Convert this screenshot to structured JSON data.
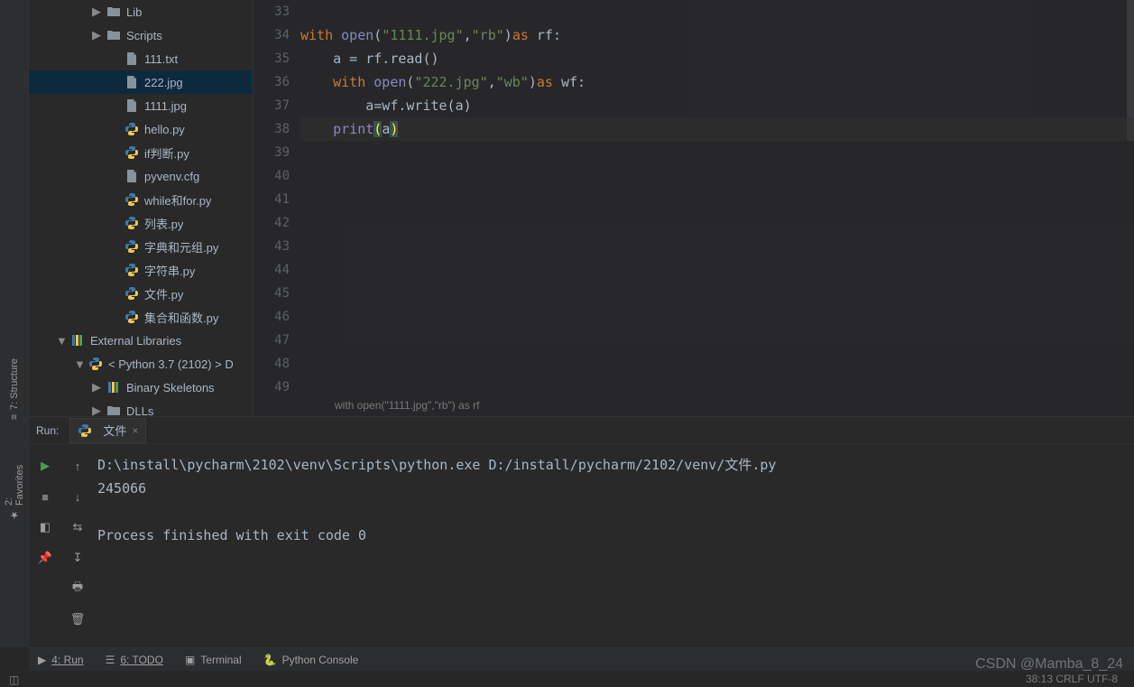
{
  "tree": [
    {
      "depth": 2,
      "exp": "▶",
      "type": "folder",
      "label": "Lib"
    },
    {
      "depth": 2,
      "exp": "▶",
      "type": "folder",
      "label": "Scripts"
    },
    {
      "depth": 3,
      "exp": "",
      "type": "file",
      "label": "111.txt"
    },
    {
      "depth": 3,
      "exp": "",
      "type": "file",
      "label": "222.jpg",
      "selected": true
    },
    {
      "depth": 3,
      "exp": "",
      "type": "file",
      "label": "1111.jpg"
    },
    {
      "depth": 3,
      "exp": "",
      "type": "py",
      "label": "hello.py"
    },
    {
      "depth": 3,
      "exp": "",
      "type": "py",
      "label": "if判断.py"
    },
    {
      "depth": 3,
      "exp": "",
      "type": "file",
      "label": "pyvenv.cfg"
    },
    {
      "depth": 3,
      "exp": "",
      "type": "py",
      "label": "while和for.py"
    },
    {
      "depth": 3,
      "exp": "",
      "type": "py",
      "label": "列表.py"
    },
    {
      "depth": 3,
      "exp": "",
      "type": "py",
      "label": "字典和元组.py"
    },
    {
      "depth": 3,
      "exp": "",
      "type": "py",
      "label": "字符串.py"
    },
    {
      "depth": 3,
      "exp": "",
      "type": "py",
      "label": "文件.py"
    },
    {
      "depth": 3,
      "exp": "",
      "type": "py",
      "label": "集合和函数.py"
    },
    {
      "depth": 0,
      "exp": "▼",
      "type": "libs",
      "label": "External Libraries"
    },
    {
      "depth": 1,
      "exp": "▼",
      "type": "pysdk",
      "label": "< Python 3.7 (2102) >  D"
    },
    {
      "depth": 2,
      "exp": "▶",
      "type": "libs",
      "label": "Binary Skeletons"
    },
    {
      "depth": 2,
      "exp": "▶",
      "type": "folder",
      "label": "DLLs"
    }
  ],
  "gutter_start": 33,
  "gutter_count": 17,
  "code": {
    "l34": {
      "kw1": "with",
      "fn": "open",
      "str1": "\"1111.jpg\"",
      "str2": "\"rb\"",
      "kw2": "as",
      "id": "rf:"
    },
    "l35": {
      "lhs": "a = rf.read()"
    },
    "l36": {
      "kw1": "with",
      "fn": "open",
      "str1": "\"222.jpg\"",
      "str2": "\"wb\"",
      "kw2": "as",
      "id": "wf:"
    },
    "l37": {
      "body": "a=wf.write(a)"
    },
    "l38": {
      "call": "print",
      "arg": "a"
    }
  },
  "breadcrumb": "with open(\"1111.jpg\",\"rb\") as rf",
  "run": {
    "label": "Run:",
    "tab": "文件",
    "output": "D:\\install\\pycharm\\2102\\venv\\Scripts\\python.exe D:/install/pycharm/2102/venv/文件.py\n245066\n\nProcess finished with exit code 0"
  },
  "left_tabs": [
    "2: Favorites",
    "7: Structure"
  ],
  "bottom": {
    "run": "4: Run",
    "todo": "6: TODO",
    "terminal": "Terminal",
    "pyconsole": "Python Console"
  },
  "status": "38:13    CRLF    UTF-8",
  "watermark": "CSDN @Mamba_8_24"
}
